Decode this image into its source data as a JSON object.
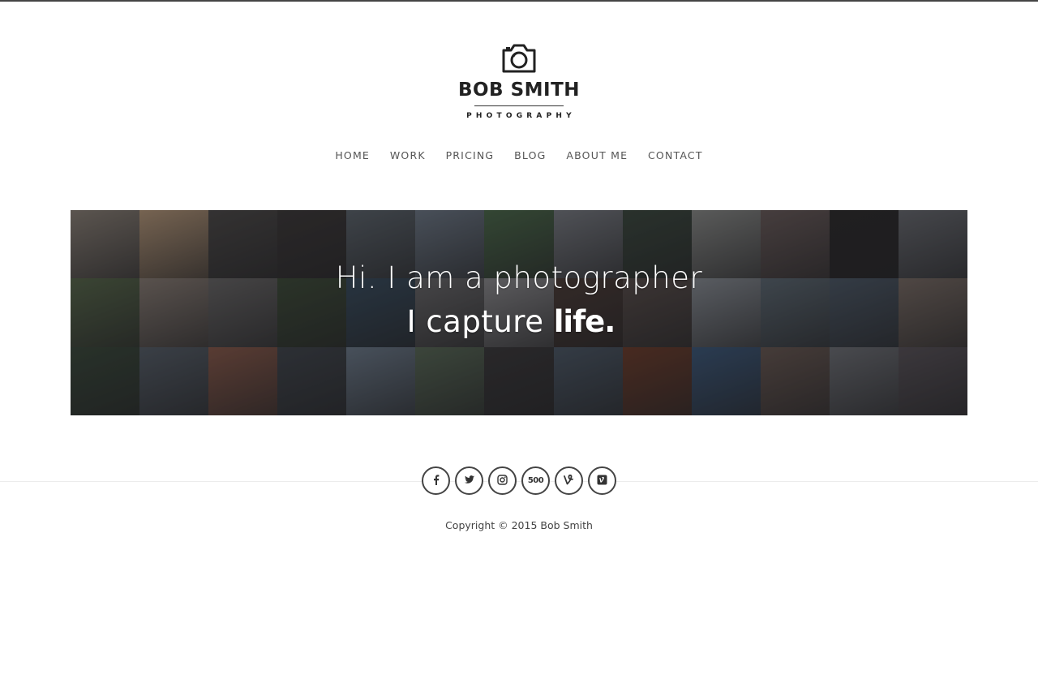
{
  "brand": {
    "name": "BOB SMITH",
    "subtitle": "PHOTOGRAPHY",
    "icon": "camera-icon"
  },
  "nav": {
    "items": [
      {
        "label": "HOME"
      },
      {
        "label": "WORK"
      },
      {
        "label": "PRICING"
      },
      {
        "label": "BLOG"
      },
      {
        "label": "ABOUT ME"
      },
      {
        "label": "CONTACT"
      }
    ]
  },
  "hero": {
    "line1": "Hi. I am a photographer",
    "line2_prefix": "I capture ",
    "line2_emphasis": "life.",
    "tile_colors": [
      "#8d8377",
      "#b89a7a",
      "#4e4b48",
      "#3e3a38",
      "#5e666c",
      "#6f7a86",
      "#4d6b4a",
      "#7a7d82",
      "#3d4a3e",
      "#8b8c88",
      "#6b5d5a",
      "#2e2c2b",
      "#6a6c70",
      "#59694a",
      "#8a7e74",
      "#6a6866",
      "#3f4d38",
      "#3a4e5e",
      "#6b6a6a",
      "#8e8d8e",
      "#4d3d36",
      "#5a4f4a",
      "#8a8f94",
      "#5e6a72",
      "#4e5a66",
      "#7a6d64",
      "#3b4a3a",
      "#586068",
      "#8a5b4a",
      "#42474c",
      "#6e7c8a",
      "#5a6a56",
      "#3c3a3a",
      "#4e5a66",
      "#6e3e2a",
      "#3e5a7a",
      "#6a5a52",
      "#707276",
      "#5a5458"
    ]
  },
  "social": {
    "icons": [
      "facebook-icon",
      "twitter-icon",
      "instagram-icon",
      "500px-icon",
      "vine-icon",
      "vimeo-icon"
    ],
    "label_500px": "500"
  },
  "footer": {
    "copyright": "Copyright © 2015 Bob Smith"
  }
}
